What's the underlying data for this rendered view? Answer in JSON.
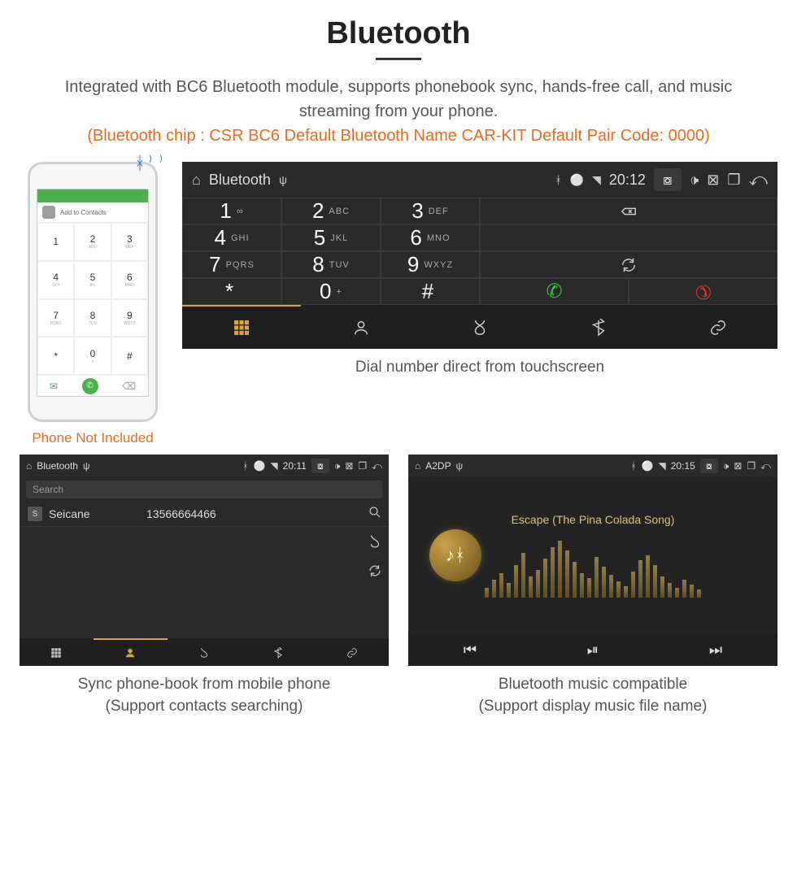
{
  "title": "Bluetooth",
  "subtitle": "Integrated with BC6 Bluetooth module, supports phonebook sync, hands-free call, and music streaming from your phone.",
  "note": "(Bluetooth chip : CSR BC6    Default Bluetooth Name CAR-KIT    Default Pair Code: 0000)",
  "phone": {
    "add_contacts": "Add to Contacts",
    "caption": "Phone Not Included",
    "keys": [
      {
        "n": "1",
        "l": ""
      },
      {
        "n": "2",
        "l": "ABC"
      },
      {
        "n": "3",
        "l": "DEF"
      },
      {
        "n": "4",
        "l": "GHI"
      },
      {
        "n": "5",
        "l": "JKL"
      },
      {
        "n": "6",
        "l": "MNO"
      },
      {
        "n": "7",
        "l": "PQRS"
      },
      {
        "n": "8",
        "l": "TUV"
      },
      {
        "n": "9",
        "l": "WXYZ"
      },
      {
        "n": "*",
        "l": ""
      },
      {
        "n": "0",
        "l": "+"
      },
      {
        "n": "#",
        "l": ""
      }
    ]
  },
  "device_main": {
    "topbar": {
      "title": "Bluetooth",
      "time": "20:12"
    },
    "keys": [
      {
        "n": "1",
        "l": "∞"
      },
      {
        "n": "2",
        "l": "ABC"
      },
      {
        "n": "3",
        "l": "DEF"
      },
      {
        "n": "4",
        "l": "GHI"
      },
      {
        "n": "5",
        "l": "JKL"
      },
      {
        "n": "6",
        "l": "MNO"
      },
      {
        "n": "7",
        "l": "PQRS"
      },
      {
        "n": "8",
        "l": "TUV"
      },
      {
        "n": "9",
        "l": "WXYZ"
      },
      {
        "n": "*",
        "l": ""
      },
      {
        "n": "0",
        "l": "+"
      },
      {
        "n": "#",
        "l": ""
      }
    ],
    "caption": "Dial number direct from touchscreen"
  },
  "panel_contacts": {
    "topbar": {
      "title": "Bluetooth",
      "time": "20:11"
    },
    "search_placeholder": "Search",
    "contacts": [
      {
        "badge": "S",
        "name": "Seicane",
        "number": "13566664466"
      }
    ],
    "caption1": "Sync phone-book from mobile phone",
    "caption2": "(Support contacts searching)"
  },
  "panel_music": {
    "topbar": {
      "title": "A2DP",
      "time": "20:15"
    },
    "track": "Escape (The Pina Colada Song)",
    "caption1": "Bluetooth music compatible",
    "caption2": "(Support display music file name)"
  }
}
